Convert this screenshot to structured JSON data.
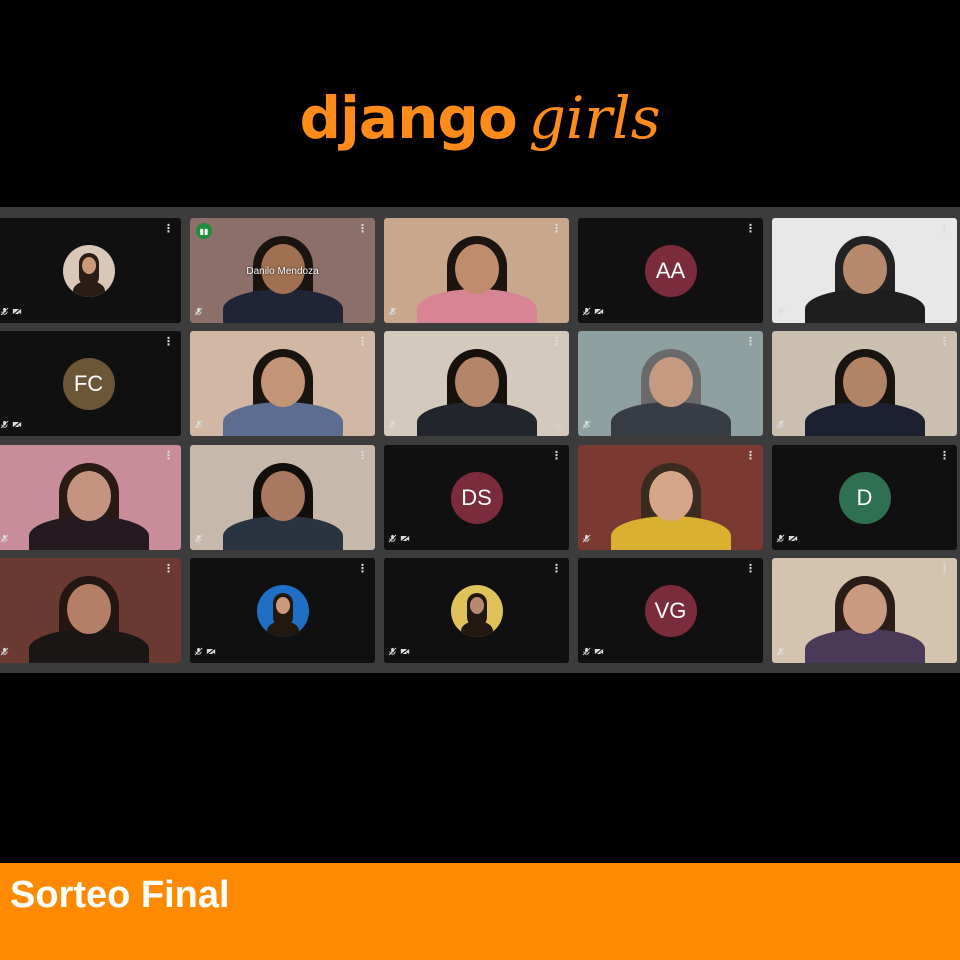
{
  "logo": {
    "word1": "django",
    "word2": "girls"
  },
  "tiles": [
    {
      "kind": "photo-circle",
      "bg": "#101010",
      "circle": "#d9c7b8",
      "skin": "#c99a7a",
      "hair": "#2a1d16"
    },
    {
      "kind": "video",
      "bg": "#8d6f6a",
      "skin": "#a07050",
      "hair": "#1a1410",
      "shirt": "#1f2436",
      "name": "Danilo Mendoza",
      "speaking": true
    },
    {
      "kind": "video",
      "bg": "#c9a78c",
      "skin": "#c08c6e",
      "hair": "#1b1410",
      "shirt": "#d98494"
    },
    {
      "kind": "initials",
      "initials": "AA",
      "color": "#7a2c3c"
    },
    {
      "kind": "video",
      "bg": "#e8e8e8",
      "skin": "#b78a6e",
      "hair": "#222",
      "shirt": "#1e1e1e"
    },
    {
      "kind": "initials",
      "initials": "FC",
      "color": "#6b5637"
    },
    {
      "kind": "video",
      "bg": "#d2b7a4",
      "skin": "#c49477",
      "hair": "#1a1410",
      "shirt": "#5c6e90"
    },
    {
      "kind": "video",
      "bg": "#d3c9bd",
      "skin": "#b5856a",
      "hair": "#17110d",
      "shirt": "#22252c",
      "pin": true
    },
    {
      "kind": "video",
      "bg": "#8fa0a0",
      "skin": "#c69a80",
      "hair": "#6a6a6a",
      "shirt": "#383c44"
    },
    {
      "kind": "video",
      "bg": "#cbbfb0",
      "skin": "#b28466",
      "hair": "#1a1410",
      "shirt": "#1c2030"
    },
    {
      "kind": "video",
      "bg": "#c98c9a",
      "skin": "#c49480",
      "hair": "#2a1a14",
      "shirt": "#241a20"
    },
    {
      "kind": "video",
      "bg": "#c6b8aa",
      "skin": "#a87860",
      "hair": "#120e0c",
      "shirt": "#2a3440"
    },
    {
      "kind": "initials",
      "initials": "DS",
      "color": "#7a2c3c"
    },
    {
      "kind": "video",
      "bg": "#7a3a32",
      "skin": "#d6a688",
      "hair": "#3a2a20",
      "shirt": "#d9b030"
    },
    {
      "kind": "initials",
      "initials": "D",
      "color": "#2f7052"
    },
    {
      "kind": "video",
      "bg": "#6a3a32",
      "skin": "#b57e66",
      "hair": "#241612",
      "shirt": "#1a1616"
    },
    {
      "kind": "photo-circle",
      "bg": "#101010",
      "circle": "#1f6fc4",
      "skin": "#c99a7a",
      "hair": "#221810"
    },
    {
      "kind": "photo-circle",
      "bg": "#101010",
      "circle": "#e0c25a",
      "skin": "#b58a70",
      "hair": "#221810"
    },
    {
      "kind": "initials",
      "initials": "VG",
      "color": "#7a2c3c"
    },
    {
      "kind": "video",
      "bg": "#d4c3ae",
      "skin": "#c99a80",
      "hair": "#2a1c16",
      "shirt": "#4a3a58"
    }
  ],
  "footer": {
    "title": "Sorteo Final"
  },
  "icons": {
    "kebab": "⋮",
    "mic_off": "mic-off-icon",
    "cam_off": "cam-off-icon"
  }
}
